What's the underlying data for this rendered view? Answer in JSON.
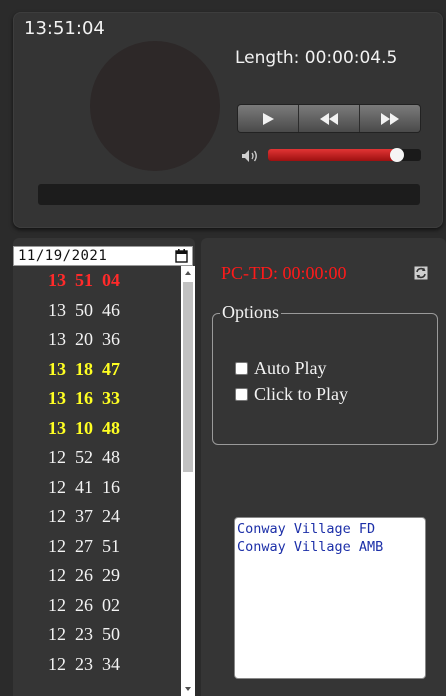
{
  "player": {
    "clock": "13:51:04",
    "length_text": "Length: 00:00:04.5",
    "volume_level": 0.84,
    "buttons": [
      "play-icon",
      "rewind-icon",
      "fast-forward-icon"
    ]
  },
  "date_picker": {
    "value": "11/19/2021",
    "icon": "calendar-icon"
  },
  "call_list": [
    {
      "time": "13 51 04",
      "style": "red"
    },
    {
      "time": "13 50 46",
      "style": "normal"
    },
    {
      "time": "13 20 36",
      "style": "normal"
    },
    {
      "time": "13 18 47",
      "style": "yellow"
    },
    {
      "time": "13 16 33",
      "style": "yellow"
    },
    {
      "time": "13 10 48",
      "style": "yellow"
    },
    {
      "time": "12 52 48",
      "style": "normal"
    },
    {
      "time": "12 41 16",
      "style": "normal"
    },
    {
      "time": "12 37 24",
      "style": "normal"
    },
    {
      "time": "12 27 51",
      "style": "normal"
    },
    {
      "time": "12 26 29",
      "style": "normal"
    },
    {
      "time": "12 26 02",
      "style": "normal"
    },
    {
      "time": "12 23 50",
      "style": "normal"
    },
    {
      "time": "12 23 34",
      "style": "normal"
    }
  ],
  "colors": {
    "red": "#ff2a2a",
    "yellow": "#ffff22",
    "normal": "#f3f3f3",
    "pctd": "#ff1a1a",
    "units_text": "#1c2fa8"
  },
  "right": {
    "pctd": "PC-TD: 00:00:00",
    "sync_icon": "sync-icon",
    "options_legend": "Options",
    "auto_play_label": "Auto Play",
    "click_to_play_label": "Click to Play",
    "units": [
      "Conway Village FD",
      "Conway Village AMB"
    ]
  }
}
